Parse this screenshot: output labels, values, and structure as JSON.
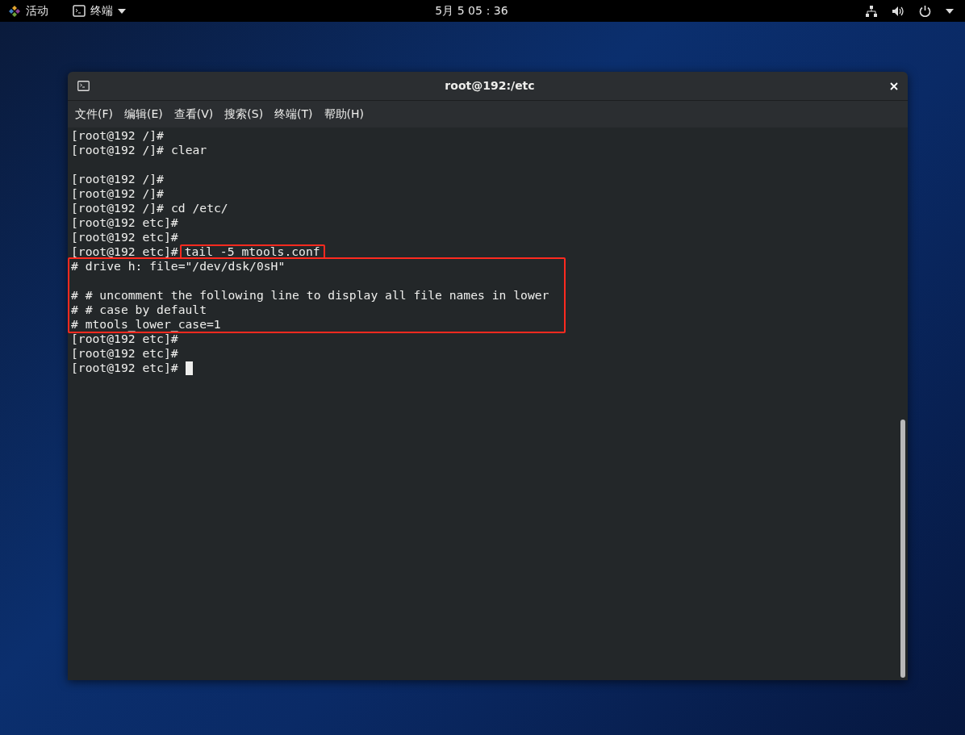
{
  "top_bar": {
    "activities": "活动",
    "app_menu": "终端",
    "clock": "5月 5 05：36"
  },
  "window": {
    "title": "root@192:/etc",
    "menu": [
      {
        "label": "文件(F)"
      },
      {
        "label": "编辑(E)"
      },
      {
        "label": "查看(V)"
      },
      {
        "label": "搜索(S)"
      },
      {
        "label": "终端(T)"
      },
      {
        "label": "帮助(H)"
      }
    ],
    "terminal": [
      {
        "kind": "prompt",
        "prompt": "[root@192 /]#"
      },
      {
        "kind": "prompt",
        "prompt": "[root@192 /]#",
        "command": "clear"
      },
      {
        "kind": "blank"
      },
      {
        "kind": "prompt",
        "prompt": "[root@192 /]#"
      },
      {
        "kind": "prompt",
        "prompt": "[root@192 /]#"
      },
      {
        "kind": "prompt",
        "prompt": "[root@192 /]#",
        "command": "cd /etc/"
      },
      {
        "kind": "prompt",
        "prompt": "[root@192 etc]#"
      },
      {
        "kind": "prompt",
        "prompt": "[root@192 etc]#"
      },
      {
        "kind": "prompt",
        "prompt": "[root@192 etc]#",
        "command": "tail -5 mtools.conf",
        "boxed": true
      },
      {
        "kind": "output",
        "boxed": true,
        "lines": [
          {
            "kind": "text",
            "text": "# drive h: file=\"/dev/dsk/0sH\""
          },
          {
            "kind": "blank"
          },
          {
            "kind": "text",
            "text": "# # uncomment the following line to display all file names in lower"
          },
          {
            "kind": "text",
            "text": "# # case by default"
          },
          {
            "kind": "text",
            "text": "# mtools_lower_case=1"
          }
        ]
      },
      {
        "kind": "prompt",
        "prompt": "[root@192 etc]#"
      },
      {
        "kind": "prompt",
        "prompt": "[root@192 etc]#"
      },
      {
        "kind": "prompt",
        "prompt": "[root@192 etc]#",
        "cursor": true
      }
    ]
  }
}
